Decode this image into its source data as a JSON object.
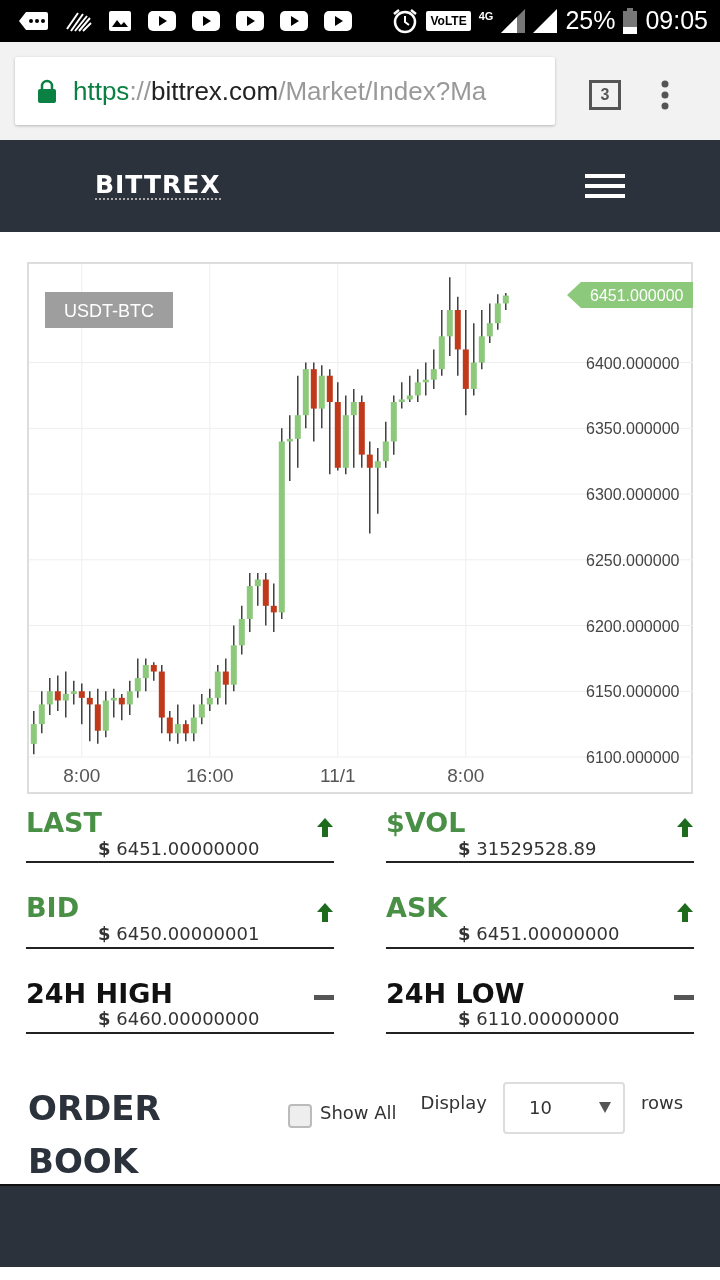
{
  "status_bar": {
    "volte": "VoLTE",
    "network": "4G",
    "battery": "25%",
    "time": "09:05"
  },
  "browser": {
    "url_scheme": "https",
    "url_separator": "://",
    "url_host": "bittrex.com",
    "url_path": "/Market/Index?Ma",
    "tab_count": "3"
  },
  "header": {
    "logo": "BITTREX"
  },
  "chart": {
    "pair": "USDT-BTC",
    "price_tag": "6451.000000",
    "chart_data": {
      "type": "candlestick",
      "categories": [
        null,
        null,
        null,
        null,
        null,
        null,
        "8:00",
        null,
        null,
        null,
        null,
        null,
        null,
        null,
        null,
        null,
        null,
        null,
        null,
        null,
        null,
        null,
        "16:00",
        null,
        null,
        null,
        null,
        null,
        null,
        null,
        null,
        null,
        null,
        null,
        null,
        null,
        null,
        null,
        "11/1",
        null,
        null,
        null,
        null,
        null,
        null,
        null,
        null,
        null,
        null,
        null,
        null,
        null,
        null,
        null,
        "8:00",
        null,
        null,
        null,
        null,
        null
      ],
      "ohlc": [
        [
          6110,
          6135,
          6102,
          6125
        ],
        [
          6125,
          6150,
          6118,
          6140
        ],
        [
          6140,
          6160,
          6132,
          6150
        ],
        [
          6150,
          6162,
          6135,
          6143
        ],
        [
          6143,
          6165,
          6130,
          6148
        ],
        [
          6148,
          6158,
          6140,
          6150
        ],
        [
          6150,
          6156,
          6125,
          6145
        ],
        [
          6145,
          6150,
          6112,
          6140
        ],
        [
          6140,
          6152,
          6110,
          6120
        ],
        [
          6120,
          6150,
          6115,
          6143
        ],
        [
          6143,
          6152,
          6130,
          6145
        ],
        [
          6145,
          6148,
          6128,
          6140
        ],
        [
          6140,
          6158,
          6132,
          6150
        ],
        [
          6150,
          6175,
          6145,
          6160
        ],
        [
          6160,
          6175,
          6150,
          6170
        ],
        [
          6170,
          6172,
          6158,
          6165
        ],
        [
          6165,
          6170,
          6118,
          6130
        ],
        [
          6130,
          6135,
          6112,
          6118
        ],
        [
          6118,
          6140,
          6110,
          6125
        ],
        [
          6125,
          6128,
          6112,
          6118
        ],
        [
          6118,
          6140,
          6112,
          6130
        ],
        [
          6130,
          6148,
          6125,
          6140
        ],
        [
          6140,
          6152,
          6135,
          6145
        ],
        [
          6145,
          6170,
          6140,
          6165
        ],
        [
          6165,
          6175,
          6140,
          6155
        ],
        [
          6155,
          6200,
          6150,
          6185
        ],
        [
          6185,
          6215,
          6178,
          6205
        ],
        [
          6205,
          6240,
          6195,
          6230
        ],
        [
          6230,
          6240,
          6215,
          6235
        ],
        [
          6235,
          6240,
          6200,
          6215
        ],
        [
          6215,
          6232,
          6195,
          6210
        ],
        [
          6210,
          6350,
          6205,
          6340
        ],
        [
          6340,
          6360,
          6310,
          6342
        ],
        [
          6342,
          6390,
          6320,
          6360
        ],
        [
          6360,
          6400,
          6350,
          6395
        ],
        [
          6395,
          6400,
          6340,
          6365
        ],
        [
          6365,
          6398,
          6350,
          6390
        ],
        [
          6390,
          6395,
          6315,
          6370
        ],
        [
          6370,
          6385,
          6318,
          6320
        ],
        [
          6320,
          6375,
          6315,
          6360
        ],
        [
          6360,
          6380,
          6320,
          6370
        ],
        [
          6370,
          6375,
          6320,
          6330
        ],
        [
          6330,
          6340,
          6270,
          6320
        ],
        [
          6320,
          6335,
          6285,
          6325
        ],
        [
          6325,
          6355,
          6320,
          6340
        ],
        [
          6340,
          6375,
          6330,
          6370
        ],
        [
          6370,
          6385,
          6365,
          6372
        ],
        [
          6372,
          6390,
          6370,
          6375
        ],
        [
          6375,
          6395,
          6370,
          6385
        ],
        [
          6385,
          6400,
          6375,
          6387
        ],
        [
          6387,
          6410,
          6380,
          6395
        ],
        [
          6395,
          6440,
          6390,
          6420
        ],
        [
          6420,
          6465,
          6405,
          6440
        ],
        [
          6440,
          6450,
          6390,
          6410
        ],
        [
          6410,
          6440,
          6360,
          6380
        ],
        [
          6380,
          6430,
          6375,
          6400
        ],
        [
          6400,
          6440,
          6395,
          6420
        ],
        [
          6420,
          6445,
          6415,
          6430
        ],
        [
          6430,
          6452,
          6425,
          6445
        ],
        [
          6445,
          6453,
          6440,
          6451
        ]
      ],
      "ylim": [
        6100,
        6475
      ],
      "grid": true,
      "yticks": [
        {
          "value": 6400,
          "label": "6400.000000"
        },
        {
          "value": 6350,
          "label": "6350.000000"
        },
        {
          "value": 6300,
          "label": "6300.000000"
        },
        {
          "value": 6250,
          "label": "6250.000000"
        },
        {
          "value": 6200,
          "label": "6200.000000"
        },
        {
          "value": 6150,
          "label": "6150.000000"
        },
        {
          "value": 6100,
          "label": "6100.000000"
        }
      ]
    }
  },
  "stats": [
    {
      "label": "LAST",
      "value": "**$** 6451.00000000",
      "kind": "up"
    },
    {
      "label": "$VOL",
      "value": "**$** 31529528.89",
      "kind": "up"
    },
    {
      "label": "BID",
      "value": "**$** 6450.00000001",
      "kind": "up"
    },
    {
      "label": "ASK",
      "value": "**$** 6451.00000000",
      "kind": "up"
    },
    {
      "label": "24H HIGH",
      "value": "**$** 6460.00000000",
      "kind": "flat"
    },
    {
      "label": "24H LOW",
      "value": "**$** 6110.00000000",
      "kind": "flat"
    }
  ],
  "order_book": {
    "title": "ORDER BOOK",
    "show_all": {
      "label": "Show All",
      "checked": false
    },
    "display_label": "Display",
    "rows_select": "10",
    "rows_label": "rows"
  }
}
